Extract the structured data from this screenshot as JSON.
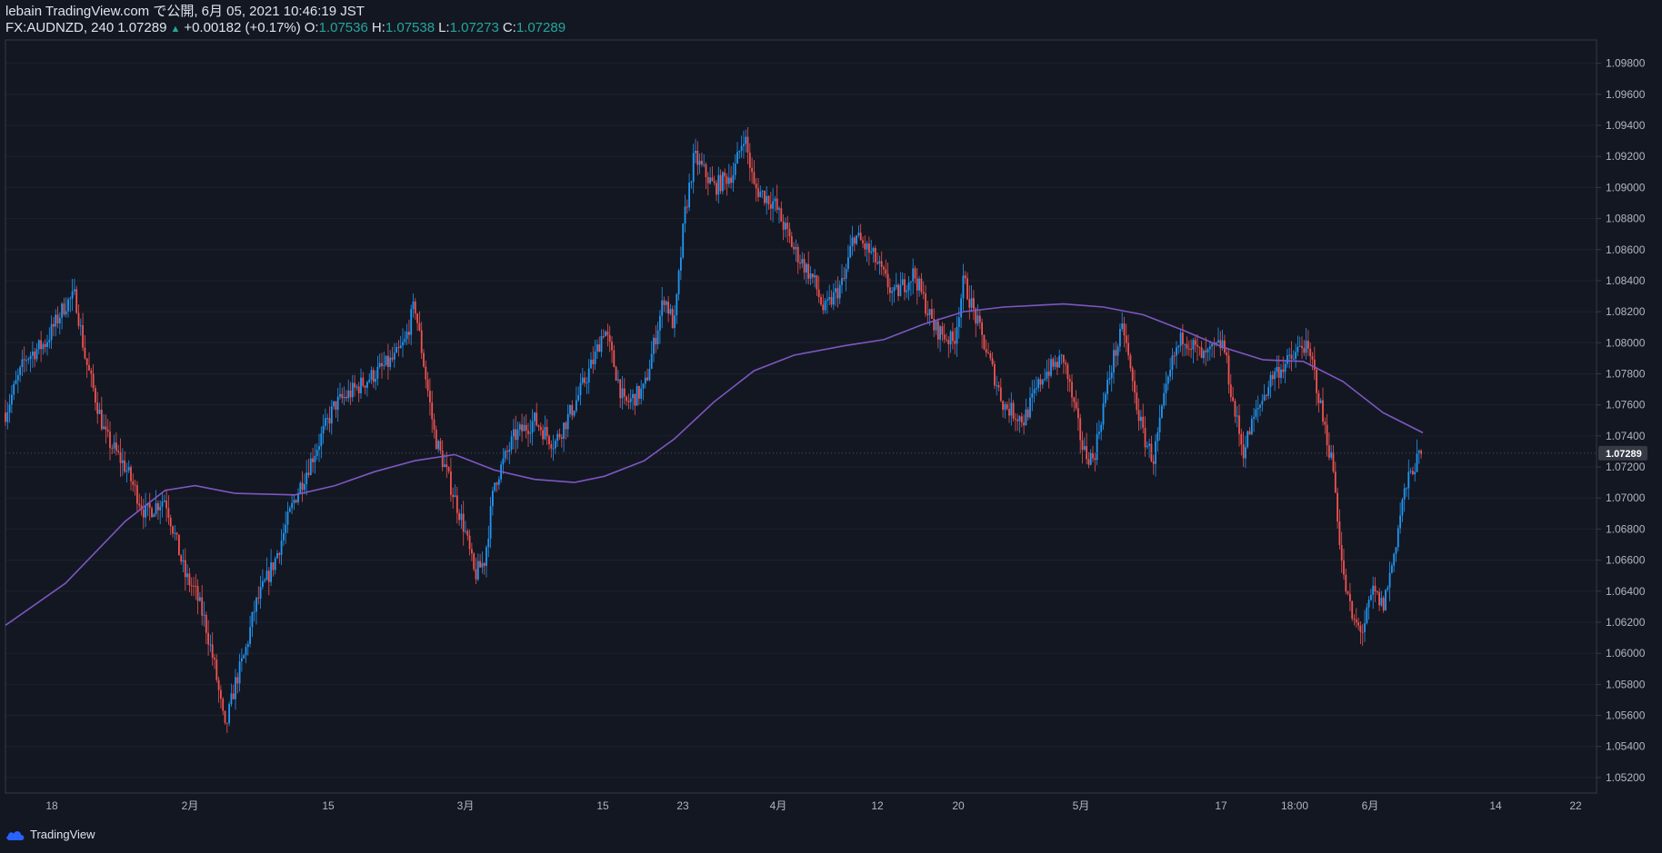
{
  "header": {
    "published": "lebain TradingView.com で公開, 6月 05, 2021 10:46:19 JST",
    "symbol": "FX:AUDNZD, 240",
    "last": "1.07289",
    "change": "+0.00182 (+0.17%)",
    "o_label": "O:",
    "o_value": "1.07536",
    "h_label": "H:",
    "h_value": "1.07538",
    "l_label": "L:",
    "l_value": "1.07273",
    "c_label": "C:",
    "c_value": "1.07289"
  },
  "footer": {
    "brand": "TradingView",
    "icon": "tradingview-cloud-icon"
  },
  "colors": {
    "background": "#131722",
    "up": "#2196f3",
    "down": "#ef5350",
    "ma": "#7e57c2",
    "grid": "#1e222d",
    "text": "#b2b5be",
    "header_value": "#26a69a"
  },
  "chart_data": {
    "type": "candlestick",
    "symbol": "FX:AUDNZD",
    "timeframe_minutes": 240,
    "ylim": [
      1.051,
      1.0995
    ],
    "y_ticks": [
      1.052,
      1.054,
      1.056,
      1.058,
      1.06,
      1.062,
      1.064,
      1.066,
      1.068,
      1.07,
      1.072,
      1.074,
      1.076,
      1.078,
      1.08,
      1.082,
      1.084,
      1.086,
      1.088,
      1.09,
      1.092,
      1.094,
      1.096,
      1.098
    ],
    "y_tick_labels": [
      "1.05200",
      "1.05400",
      "1.05600",
      "1.05800",
      "1.06000",
      "1.06200",
      "1.06400",
      "1.06600",
      "1.06800",
      "1.07000",
      "1.07200",
      "1.07400",
      "1.07600",
      "1.07800",
      "1.08000",
      "1.08200",
      "1.08400",
      "1.08600",
      "1.08800",
      "1.09000",
      "1.09200",
      "1.09400",
      "1.09600",
      "1.09800"
    ],
    "last_price": 1.07289,
    "last_price_label": "1.07289",
    "x_ticks": [
      "18",
      "2月",
      "15",
      "3月",
      "15",
      "23",
      "4月",
      "12",
      "20",
      "5月",
      "17",
      "18:00",
      "6月",
      "14",
      "22"
    ],
    "price_path": [
      [
        "2021-01-14",
        1.0755
      ],
      [
        "2021-01-16",
        1.079
      ],
      [
        "2021-01-18",
        1.08
      ],
      [
        "2021-01-20",
        1.0825
      ],
      [
        "2021-01-21",
        1.083
      ],
      [
        "2021-01-22",
        1.079
      ],
      [
        "2021-01-24",
        1.074
      ],
      [
        "2021-01-26",
        1.072
      ],
      [
        "2021-01-28",
        1.069
      ],
      [
        "2021-01-30",
        1.07
      ],
      [
        "2021-02-01",
        1.065
      ],
      [
        "2021-02-02",
        1.064
      ],
      [
        "2021-02-03",
        1.062
      ],
      [
        "2021-02-04",
        1.059
      ],
      [
        "2021-02-05",
        1.055
      ],
      [
        "2021-02-06",
        1.058
      ],
      [
        "2021-02-07",
        1.06
      ],
      [
        "2021-02-08",
        1.063
      ],
      [
        "2021-02-10",
        1.066
      ],
      [
        "2021-02-12",
        1.07
      ],
      [
        "2021-02-14",
        1.073
      ],
      [
        "2021-02-16",
        1.076
      ],
      [
        "2021-02-18",
        1.077
      ],
      [
        "2021-02-20",
        1.078
      ],
      [
        "2021-02-22",
        1.079
      ],
      [
        "2021-02-23",
        1.08
      ],
      [
        "2021-02-24",
        1.0825
      ],
      [
        "2021-02-26",
        1.074
      ],
      [
        "2021-02-28",
        1.07
      ],
      [
        "2021-03-01",
        1.068
      ],
      [
        "2021-03-02",
        1.065
      ],
      [
        "2021-03-03",
        1.066
      ],
      [
        "2021-03-04",
        1.071
      ],
      [
        "2021-03-06",
        1.074
      ],
      [
        "2021-03-08",
        1.075
      ],
      [
        "2021-03-10",
        1.0735
      ],
      [
        "2021-03-12",
        1.076
      ],
      [
        "2021-03-14",
        1.079
      ],
      [
        "2021-03-15",
        1.081
      ],
      [
        "2021-03-17",
        1.076
      ],
      [
        "2021-03-19",
        1.077
      ],
      [
        "2021-03-21",
        1.083
      ],
      [
        "2021-03-22",
        1.081
      ],
      [
        "2021-03-23",
        1.088
      ],
      [
        "2021-03-24",
        1.092
      ],
      [
        "2021-03-26",
        1.09
      ],
      [
        "2021-03-28",
        1.091
      ],
      [
        "2021-03-29",
        1.0935
      ],
      [
        "2021-03-30",
        1.09
      ],
      [
        "2021-04-01",
        1.089
      ],
      [
        "2021-04-03",
        1.086
      ],
      [
        "2021-04-05",
        1.084
      ],
      [
        "2021-04-06",
        1.082
      ],
      [
        "2021-04-08",
        1.084
      ],
      [
        "2021-04-09",
        1.087
      ],
      [
        "2021-04-11",
        1.0855
      ],
      [
        "2021-04-13",
        1.083
      ],
      [
        "2021-04-15",
        1.0845
      ],
      [
        "2021-04-17",
        1.081
      ],
      [
        "2021-04-19",
        1.08
      ],
      [
        "2021-04-20",
        1.084
      ],
      [
        "2021-04-22",
        1.08
      ],
      [
        "2021-04-24",
        1.076
      ],
      [
        "2021-04-26",
        1.075
      ],
      [
        "2021-04-28",
        1.078
      ],
      [
        "2021-04-30",
        1.079
      ],
      [
        "2021-05-02",
        1.073
      ],
      [
        "2021-05-03",
        1.0725
      ],
      [
        "2021-05-04",
        1.076
      ],
      [
        "2021-05-05",
        1.079
      ],
      [
        "2021-05-06",
        1.081
      ],
      [
        "2021-05-07",
        1.077
      ],
      [
        "2021-05-08",
        1.074
      ],
      [
        "2021-05-09",
        1.0725
      ],
      [
        "2021-05-10",
        1.076
      ],
      [
        "2021-05-11",
        1.079
      ],
      [
        "2021-05-12",
        1.0805
      ],
      [
        "2021-05-14",
        1.079
      ],
      [
        "2021-05-16",
        1.08
      ],
      [
        "2021-05-17",
        1.076
      ],
      [
        "2021-05-18",
        1.073
      ],
      [
        "2021-05-19",
        1.075
      ],
      [
        "2021-05-21",
        1.078
      ],
      [
        "2021-05-23",
        1.079
      ],
      [
        "2021-05-24",
        1.08
      ],
      [
        "2021-05-25",
        1.0785
      ],
      [
        "2021-05-26",
        1.075
      ],
      [
        "2021-05-27",
        1.072
      ],
      [
        "2021-05-28",
        1.065
      ],
      [
        "2021-05-29",
        1.062
      ],
      [
        "2021-05-30",
        1.0615
      ],
      [
        "2021-05-31",
        1.064
      ],
      [
        "2021-06-01",
        1.063
      ],
      [
        "2021-06-02",
        1.066
      ],
      [
        "2021-06-03",
        1.07
      ],
      [
        "2021-06-04",
        1.072
      ],
      [
        "2021-06-05",
        1.07289
      ]
    ],
    "moving_average": [
      [
        "2021-01-14",
        1.0618
      ],
      [
        "2021-01-20",
        1.0645
      ],
      [
        "2021-01-26",
        1.0685
      ],
      [
        "2021-01-30",
        1.0705
      ],
      [
        "2021-02-02",
        1.0708
      ],
      [
        "2021-02-06",
        1.0703
      ],
      [
        "2021-02-12",
        1.0702
      ],
      [
        "2021-02-16",
        1.0708
      ],
      [
        "2021-02-20",
        1.0717
      ],
      [
        "2021-02-24",
        1.0724
      ],
      [
        "2021-02-28",
        1.0728
      ],
      [
        "2021-03-04",
        1.0718
      ],
      [
        "2021-03-08",
        1.0712
      ],
      [
        "2021-03-12",
        1.071
      ],
      [
        "2021-03-15",
        1.0714
      ],
      [
        "2021-03-19",
        1.0724
      ],
      [
        "2021-03-22",
        1.0738
      ],
      [
        "2021-03-26",
        1.0762
      ],
      [
        "2021-03-30",
        1.0782
      ],
      [
        "2021-04-03",
        1.0792
      ],
      [
        "2021-04-08",
        1.0798
      ],
      [
        "2021-04-12",
        1.0802
      ],
      [
        "2021-04-16",
        1.0812
      ],
      [
        "2021-04-20",
        1.082
      ],
      [
        "2021-04-24",
        1.0823
      ],
      [
        "2021-04-30",
        1.0825
      ],
      [
        "2021-05-04",
        1.0823
      ],
      [
        "2021-05-08",
        1.0818
      ],
      [
        "2021-05-12",
        1.0808
      ],
      [
        "2021-05-16",
        1.0797
      ],
      [
        "2021-05-20",
        1.0789
      ],
      [
        "2021-05-24",
        1.0788
      ],
      [
        "2021-05-28",
        1.0775
      ],
      [
        "2021-06-01",
        1.0755
      ],
      [
        "2021-06-05",
        1.0742
      ]
    ]
  }
}
